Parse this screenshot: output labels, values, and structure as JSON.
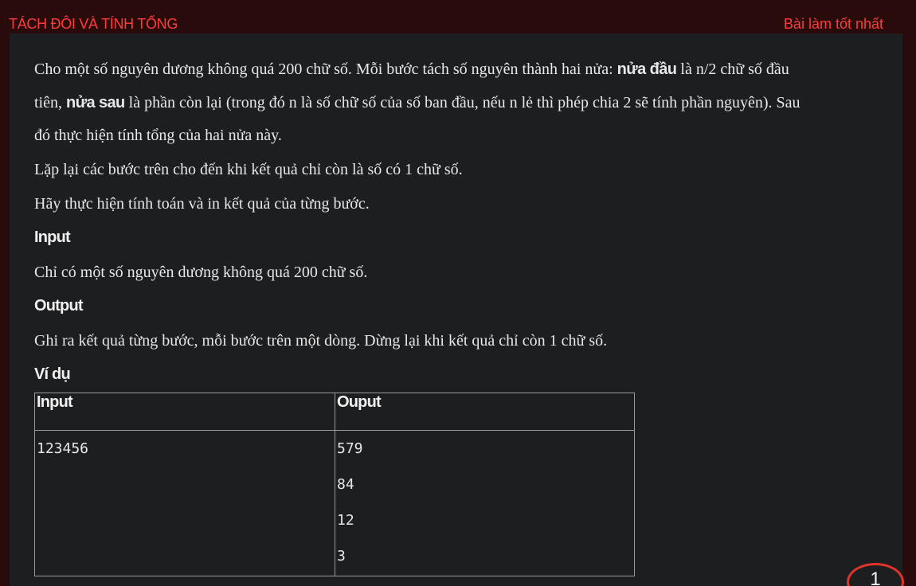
{
  "header": {
    "title": "TÁCH ĐÔI VÀ TÍNH TỔNG",
    "best_link": "Bài làm tốt nhất"
  },
  "statement": {
    "line1_a": "Cho một số nguyên dương không quá 200 chữ số. Mỗi bước tách số nguyên thành hai nửa: ",
    "line1_bold": "nửa đầu",
    "line1_b": " là n/2 chữ số đầu",
    "line2_a": "tiên, ",
    "line2_bold": "nửa sau",
    "line2_b": " là phần còn lại (trong đó n là số chữ số của số ban đầu, nếu n lẻ thì phép chia 2 sẽ tính phần nguyên). Sau",
    "line3": "đó thực hiện tính tổng của hai nửa này.",
    "line4": "Lặp lại các bước trên cho đến khi kết quả chỉ còn là số có 1 chữ số.",
    "line5": "Hãy thực hiện tính toán và in kết quả của từng bước."
  },
  "input_section": {
    "heading": "Input",
    "text": "Chỉ có một số nguyên dương không quá 200 chữ số."
  },
  "output_section": {
    "heading": "Output",
    "text": "Ghi ra kết quả từng bước, mỗi bước trên một dòng. Dừng lại khi kết quả chỉ còn 1 chữ số."
  },
  "example": {
    "heading": "Ví dụ",
    "columns": [
      "Input",
      "Ouput"
    ],
    "input": "123456",
    "output_lines": [
      "579",
      "84",
      "12",
      "3"
    ]
  },
  "badge": {
    "count": "1"
  },
  "colors": {
    "accent": "#ff3b3b",
    "page_bg": "#2a0b0b",
    "content_bg": "#1d1e20",
    "text": "#e8e8e8"
  }
}
